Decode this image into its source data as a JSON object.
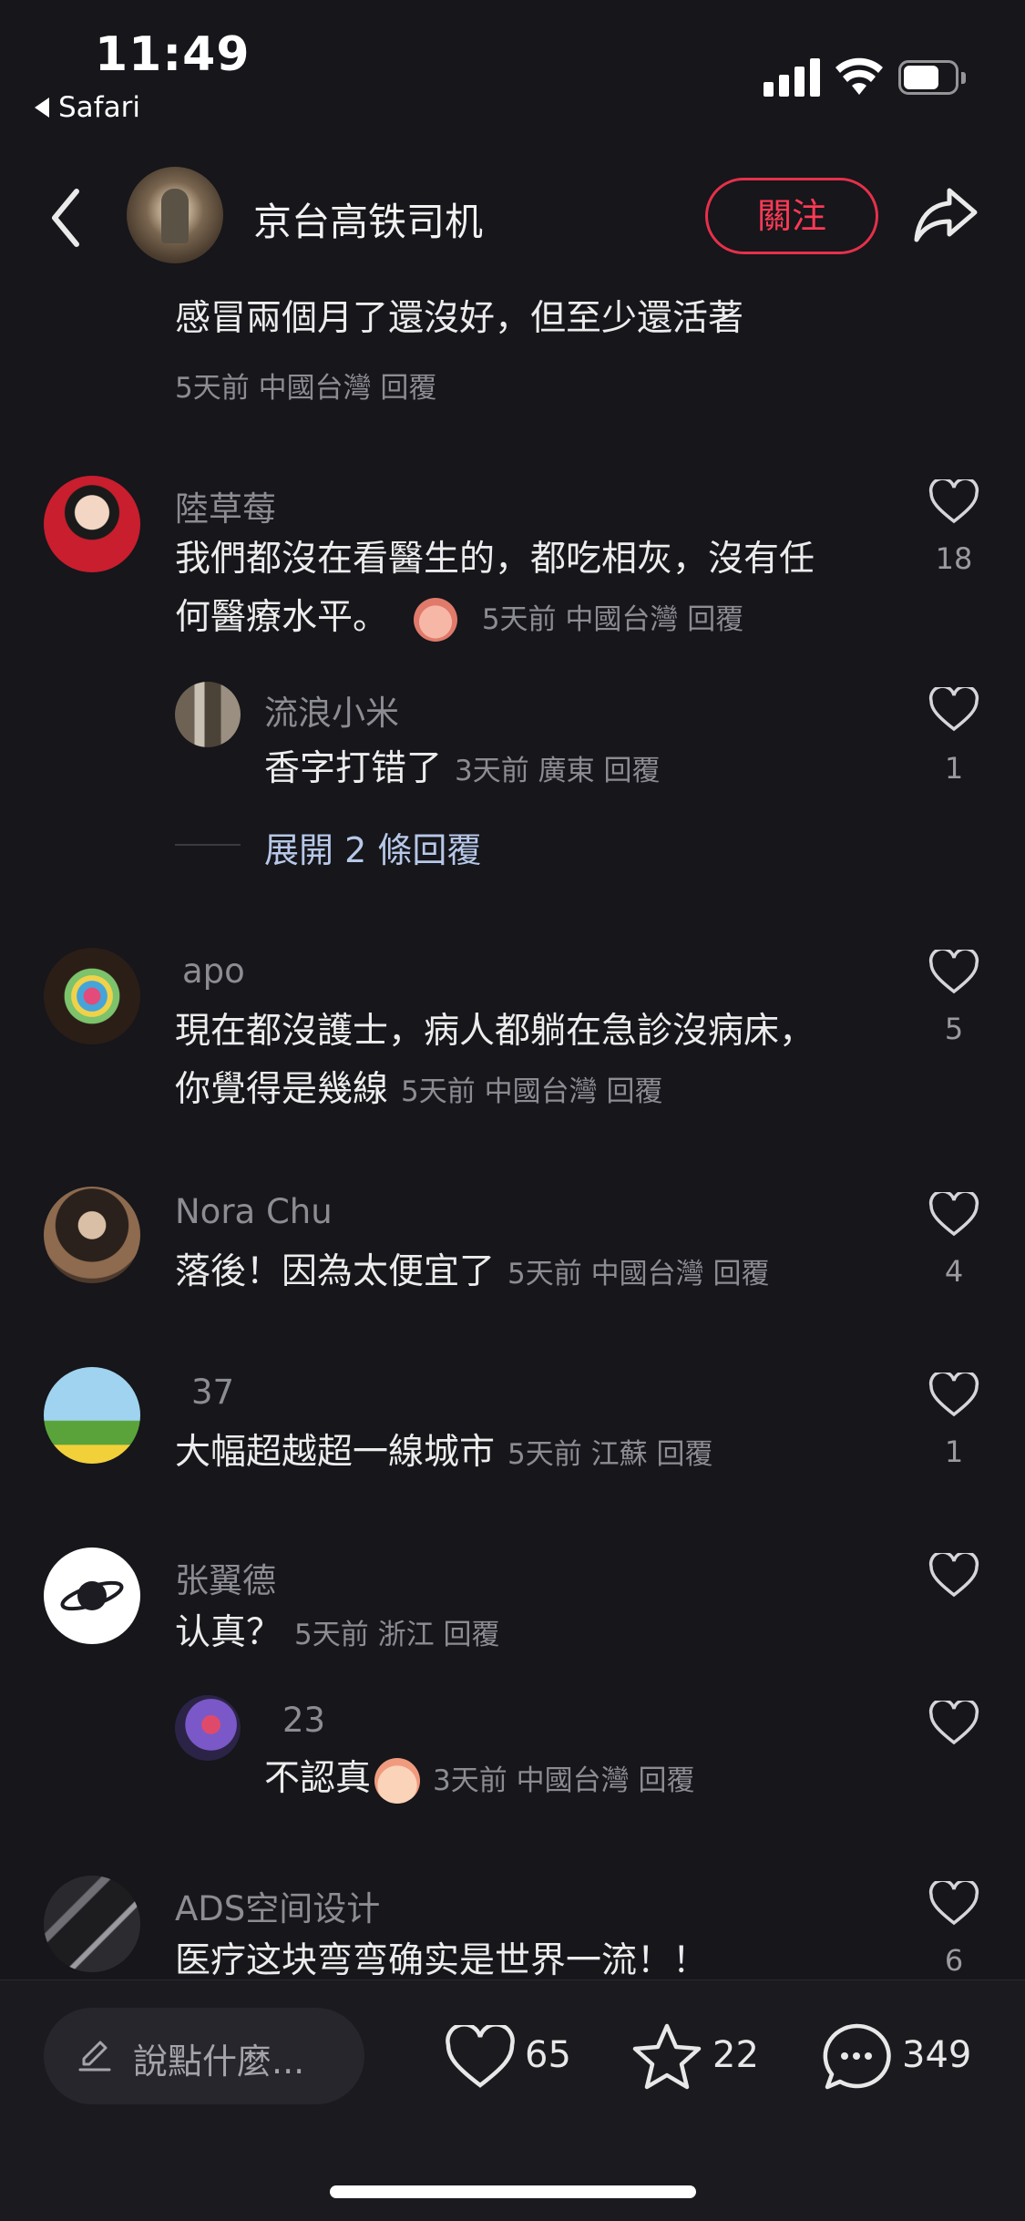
{
  "status": {
    "time": "11:49",
    "back_app": "Safari"
  },
  "header": {
    "name": "京台高铁司机",
    "follow_label": "關注"
  },
  "comments": [
    {
      "text": "感冒兩個月了還沒好，但至少還活著",
      "meta": "5天前 中國台灣 回覆"
    },
    {
      "user": "陸草莓",
      "text_line1": "我們都沒在看醫生的，都吃相灰，沒有任",
      "text_line2": "何醫療水平。",
      "meta": "5天前 中國台灣 回覆",
      "likes": "18"
    },
    {
      "user": "流浪小米",
      "text": "香字打错了",
      "meta": "3天前 廣東 回覆",
      "likes": "1"
    },
    {
      "expand": "展開 2 條回覆"
    },
    {
      "user": "apo",
      "text_line1": "現在都沒護士，病人都躺在急診沒病床，",
      "text_line2": "你覺得是幾線",
      "meta": "5天前 中國台灣 回覆",
      "likes": "5"
    },
    {
      "user": "Nora Chu",
      "text": "落後！因為太便宜了",
      "meta": "5天前 中國台灣 回覆",
      "likes": "4"
    },
    {
      "user": "37",
      "text": "大幅超越超一線城市",
      "meta": "5天前 江蘇 回覆",
      "likes": "1"
    },
    {
      "user": "张翼德",
      "text": "认真？",
      "meta": "5天前 浙江 回覆",
      "likes": ""
    },
    {
      "user": "23",
      "text": "不認真",
      "meta": "3天前 中國台灣 回覆",
      "likes": ""
    },
    {
      "user": "ADS空间设计",
      "text": "医疗这块弯弯确实是世界一流！！",
      "likes": "6"
    }
  ],
  "bottom": {
    "placeholder": "說點什麼...",
    "likes": "65",
    "favorites": "22",
    "comments": "349"
  },
  "colors": {
    "accent": "#ff3a55",
    "background": "#16161b",
    "muted": "#8c8c93"
  },
  "icons": [
    "back-chevron-icon",
    "share-arrow-icon",
    "heart-icon",
    "star-icon",
    "chat-bubble-icon",
    "pencil-icon",
    "wifi-icon",
    "battery-icon",
    "signal-icon"
  ]
}
